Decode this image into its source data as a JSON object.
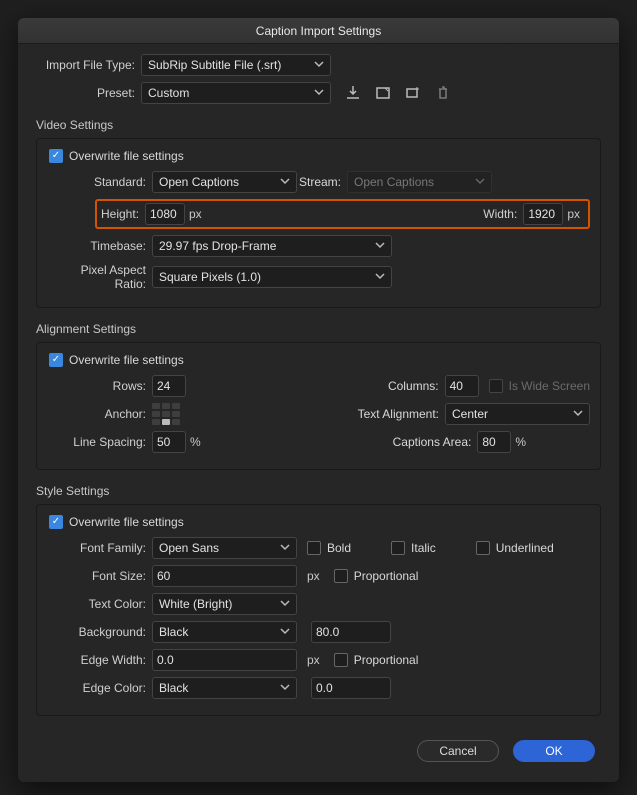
{
  "title": "Caption Import Settings",
  "top": {
    "file_type_label": "Import File Type:",
    "file_type_value": "SubRip Subtitle File (.srt)",
    "preset_label": "Preset:",
    "preset_value": "Custom"
  },
  "video": {
    "section_title": "Video Settings",
    "overwrite_label": "Overwrite file settings",
    "overwrite_checked": true,
    "standard_label": "Standard:",
    "standard_value": "Open Captions",
    "stream_label": "Stream:",
    "stream_value": "Open Captions",
    "height_label": "Height:",
    "height_value": "1080",
    "width_label": "Width:",
    "width_value": "1920",
    "px_unit": "px",
    "timebase_label": "Timebase:",
    "timebase_value": "29.97 fps Drop-Frame",
    "par_label": "Pixel Aspect Ratio:",
    "par_value": "Square Pixels (1.0)"
  },
  "align": {
    "section_title": "Alignment Settings",
    "overwrite_label": "Overwrite file settings",
    "rows_label": "Rows:",
    "rows_value": "24",
    "columns_label": "Columns:",
    "columns_value": "40",
    "widescreen_label": "Is Wide Screen",
    "anchor_label": "Anchor:",
    "text_align_label": "Text Alignment:",
    "text_align_value": "Center",
    "line_spacing_label": "Line Spacing:",
    "line_spacing_value": "50",
    "captions_area_label": "Captions Area:",
    "captions_area_value": "80",
    "pct_unit": "%"
  },
  "style": {
    "section_title": "Style Settings",
    "overwrite_label": "Overwrite file settings",
    "font_family_label": "Font Family:",
    "font_family_value": "Open Sans",
    "bold_label": "Bold",
    "italic_label": "Italic",
    "underlined_label": "Underlined",
    "font_size_label": "Font Size:",
    "font_size_value": "60",
    "px_unit": "px",
    "proportional_label": "Proportional",
    "text_color_label": "Text Color:",
    "text_color_value": "White (Bright)",
    "background_label": "Background:",
    "background_value": "Black",
    "background_opacity": "80.0",
    "edge_width_label": "Edge Width:",
    "edge_width_value": "0.0",
    "edge_color_label": "Edge Color:",
    "edge_color_value": "Black",
    "edge_color_extra": "0.0"
  },
  "footer": {
    "cancel": "Cancel",
    "ok": "OK"
  }
}
